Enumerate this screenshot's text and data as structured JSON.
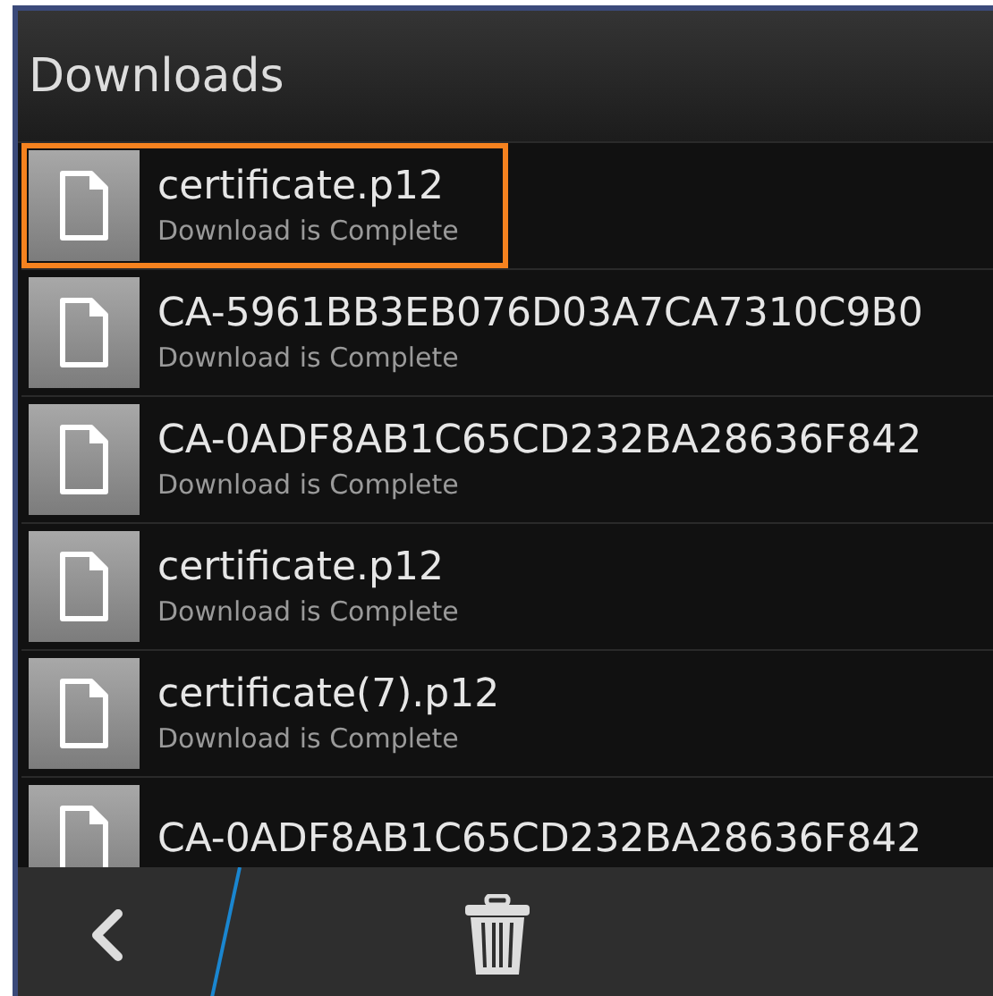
{
  "header": {
    "title": "Downloads"
  },
  "downloads": [
    {
      "name": "certificate.p12",
      "status": "Download is Complete",
      "selected": true
    },
    {
      "name": "CA-5961BB3EB076D03A7CA7310C9B0",
      "status": "Download is Complete",
      "selected": false
    },
    {
      "name": "CA-0ADF8AB1C65CD232BA28636F842",
      "status": "Download is Complete",
      "selected": false
    },
    {
      "name": "certificate.p12",
      "status": "Download is Complete",
      "selected": false
    },
    {
      "name": "certificate(7).p12",
      "status": "Download is Complete",
      "selected": false
    },
    {
      "name": "CA-0ADF8AB1C65CD232BA28636F842",
      "selected": false
    }
  ]
}
